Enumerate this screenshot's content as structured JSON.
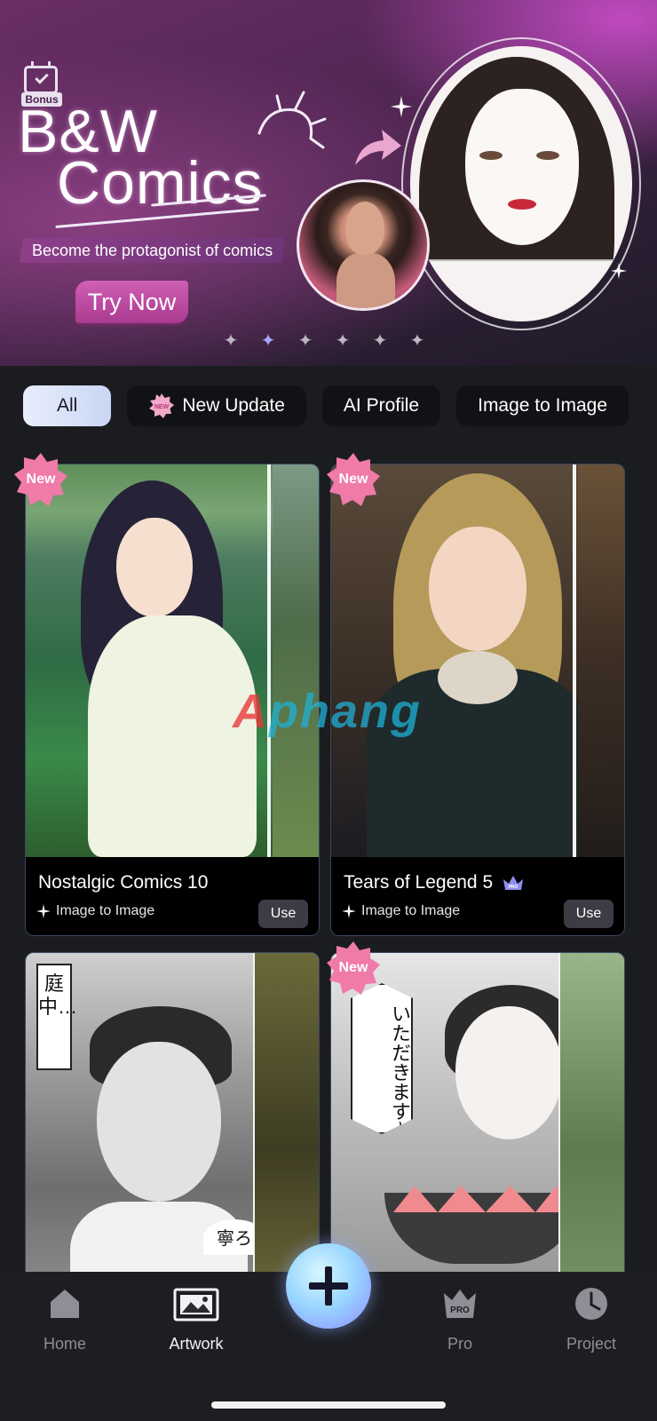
{
  "banner": {
    "badge_label": "Bonus",
    "title_line1": "B&W",
    "title_line2": "Comics",
    "tagline": "Become the protagonist of comics",
    "cta_label": "Try Now",
    "pager": {
      "count": 6,
      "active_index": 1,
      "glyph": "✦"
    }
  },
  "tabs": [
    {
      "label": "All",
      "active": true
    },
    {
      "label": "New Update",
      "badge": "NEW"
    },
    {
      "label": "AI Profile"
    },
    {
      "label": "Image to Image"
    }
  ],
  "cards": [
    {
      "title": "Nostalgic Comics 10",
      "type": "Image to Image",
      "use_label": "Use",
      "new": true,
      "pro": false
    },
    {
      "title": "Tears of Legend 5",
      "type": "Image to Image",
      "use_label": "Use",
      "new": true,
      "pro": true,
      "pro_badge": "PRO"
    },
    {
      "title": "",
      "type": "",
      "new": false,
      "speech": "庭中…",
      "corner_text": "寧ろ"
    },
    {
      "title": "",
      "type": "",
      "new": true,
      "speech": "いただきます~"
    }
  ],
  "new_tag_label": "New",
  "watermark": {
    "first": "A",
    "rest": "phang"
  },
  "nav": {
    "items": [
      {
        "label": "Home",
        "icon": "home-icon"
      },
      {
        "label": "Artwork",
        "icon": "artwork-icon",
        "active": true
      },
      {
        "label": "Pro",
        "icon": "pro-crown-icon",
        "badge": "PRO"
      },
      {
        "label": "Project",
        "icon": "clock-icon"
      }
    ],
    "fab_icon": "plus-icon"
  },
  "colors": {
    "accent": "#a9a6ff",
    "cta": "#c04ea8",
    "new_tag": "#f07aa8",
    "card_border": "#3b4760",
    "background": "#1b1c20"
  }
}
